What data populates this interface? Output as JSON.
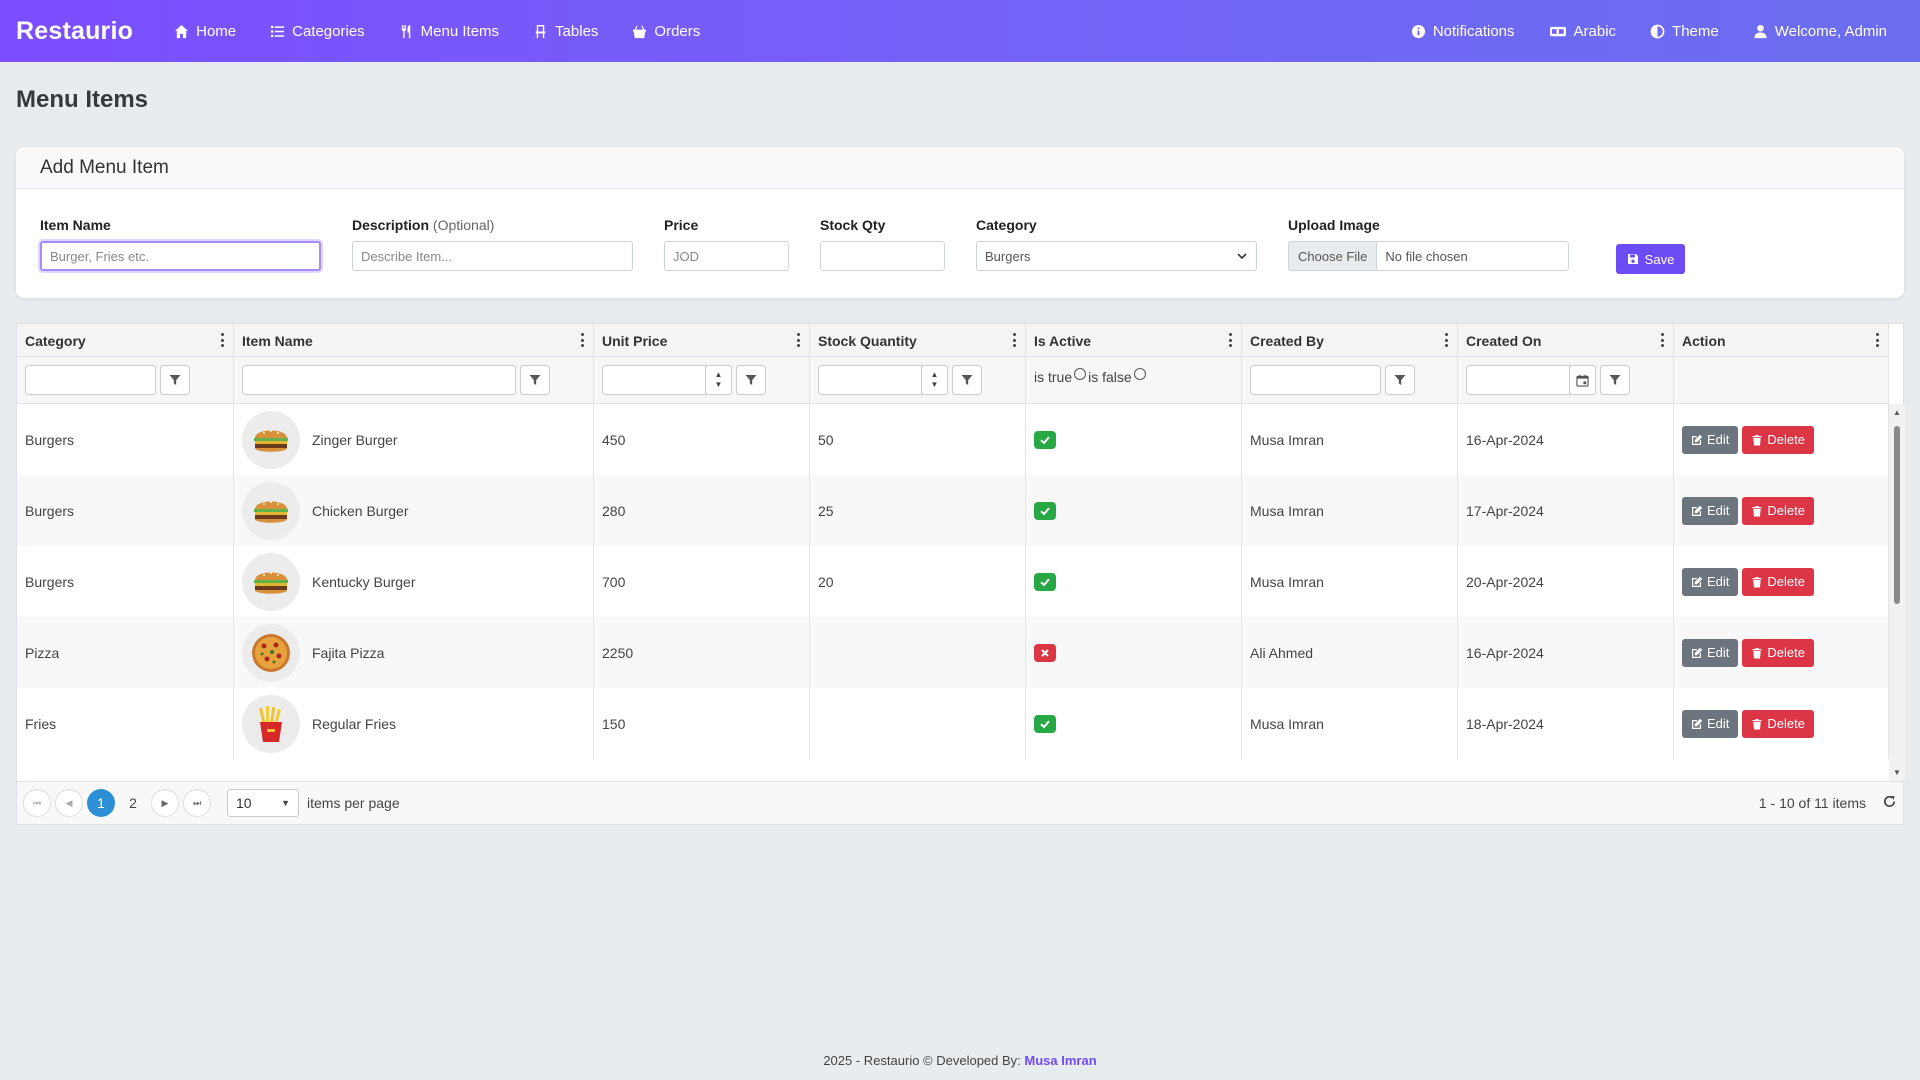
{
  "app": {
    "brand": "Restaurio"
  },
  "nav": {
    "left": [
      {
        "label": "Home",
        "icon": "home-icon"
      },
      {
        "label": "Categories",
        "icon": "list-icon"
      },
      {
        "label": "Menu Items",
        "icon": "utensils-icon"
      },
      {
        "label": "Tables",
        "icon": "chair-icon"
      },
      {
        "label": "Orders",
        "icon": "basket-icon"
      }
    ],
    "right": [
      {
        "label": "Notifications",
        "icon": "info-icon"
      },
      {
        "label": "Arabic",
        "icon": "language-icon"
      },
      {
        "label": "Theme",
        "icon": "contrast-icon"
      },
      {
        "label": "Welcome, Admin",
        "icon": "user-icon"
      }
    ]
  },
  "page": {
    "title": "Menu Items"
  },
  "form": {
    "header": "Add Menu Item",
    "item_name": {
      "label": "Item Name",
      "placeholder": "Burger, Fries etc."
    },
    "description": {
      "label": "Description",
      "optional": "(Optional)",
      "placeholder": "Describe Item..."
    },
    "price": {
      "label": "Price",
      "placeholder": "JOD"
    },
    "stock": {
      "label": "Stock Qty",
      "placeholder": ""
    },
    "category": {
      "label": "Category",
      "value": "Burgers"
    },
    "upload": {
      "label": "Upload Image",
      "choose": "Choose File",
      "chosen": "No file chosen"
    },
    "save_label": "Save"
  },
  "grid": {
    "columns": [
      "Category",
      "Item Name",
      "Unit Price",
      "Stock Quantity",
      "Is Active",
      "Created By",
      "Created On",
      "Action"
    ],
    "bool_filter": {
      "true_label": "is true",
      "false_label": "is false"
    },
    "rows": [
      {
        "category": "Burgers",
        "name": "Zinger Burger",
        "price": "450",
        "stock": "50",
        "active": true,
        "created_by": "Musa Imran",
        "created_on": "16-Apr-2024",
        "img": "burger"
      },
      {
        "category": "Burgers",
        "name": "Chicken Burger",
        "price": "280",
        "stock": "25",
        "active": true,
        "created_by": "Musa Imran",
        "created_on": "17-Apr-2024",
        "img": "burger"
      },
      {
        "category": "Burgers",
        "name": "Kentucky Burger",
        "price": "700",
        "stock": "20",
        "active": true,
        "created_by": "Musa Imran",
        "created_on": "20-Apr-2024",
        "img": "burger"
      },
      {
        "category": "Pizza",
        "name": "Fajita Pizza",
        "price": "2250",
        "stock": "",
        "active": false,
        "created_by": "Ali Ahmed",
        "created_on": "16-Apr-2024",
        "img": "pizza"
      },
      {
        "category": "Fries",
        "name": "Regular Fries",
        "price": "150",
        "stock": "",
        "active": true,
        "created_by": "Musa Imran",
        "created_on": "18-Apr-2024",
        "img": "fries"
      }
    ],
    "edit_label": "Edit",
    "delete_label": "Delete"
  },
  "pager": {
    "pages": [
      "1",
      "2"
    ],
    "current_page": "1",
    "page_size": "10",
    "items_per_page_label": "items per page",
    "info": "1 - 10 of 11 items"
  },
  "footer": {
    "text": "2025 - Restaurio © Developed By: ",
    "author": "Musa Imran"
  },
  "colors": {
    "primary": "#6d4cf6",
    "success": "#28a745",
    "danger": "#dc3545",
    "secondary": "#6c757d",
    "pager_active": "#2d8fd6"
  }
}
